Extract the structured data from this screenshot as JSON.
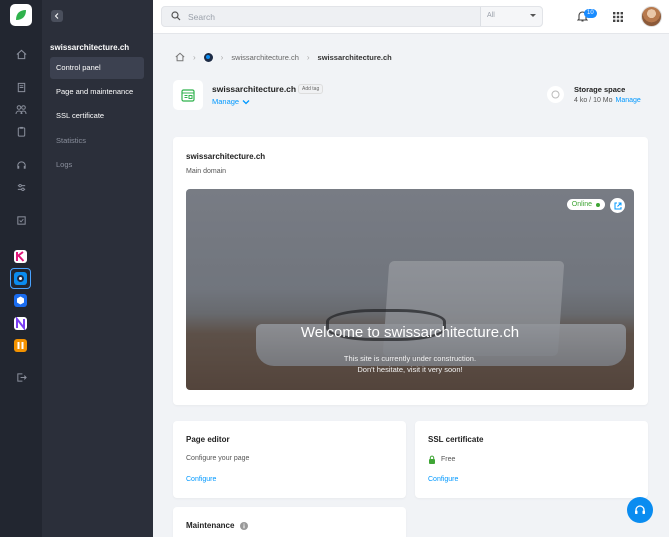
{
  "topbar": {
    "search_placeholder": "Search",
    "filter_value": "All",
    "notifications_count": "10"
  },
  "sidebar": {
    "site_name": "swissarchitecture.ch",
    "items": [
      {
        "label": "Control panel"
      },
      {
        "label": "Page and maintenance"
      },
      {
        "label": "SSL certificate"
      },
      {
        "label": "Statistics"
      },
      {
        "label": "Logs"
      }
    ]
  },
  "breadcrumb": {
    "items": [
      "swissarchitecture.ch",
      "swissarchitecture.ch"
    ]
  },
  "header": {
    "title": "swissarchitecture.ch",
    "add_tag": "Add tag",
    "manage": "Manage",
    "storage_label": "Storage space",
    "storage_value": "4 ko / 10 Mo",
    "storage_manage": "Manage"
  },
  "domain_card": {
    "title": "swissarchitecture.ch",
    "subtitle": "Main domain",
    "status": "Online",
    "preview_title": "Welcome to swissarchitecture.ch",
    "preview_line1": "This site is currently under construction.",
    "preview_line2": "Don't hesitate, visit it very soon!"
  },
  "page_editor": {
    "title": "Page editor",
    "description": "Configure your page",
    "link": "Configure"
  },
  "ssl": {
    "title": "SSL certificate",
    "status": "Free",
    "link": "Configure"
  },
  "maintenance": {
    "title": "Maintenance"
  },
  "colors": {
    "accent": "#0098ff",
    "online": "#3fa535",
    "rail": "#222630",
    "sidebar": "#2b2f3a"
  }
}
